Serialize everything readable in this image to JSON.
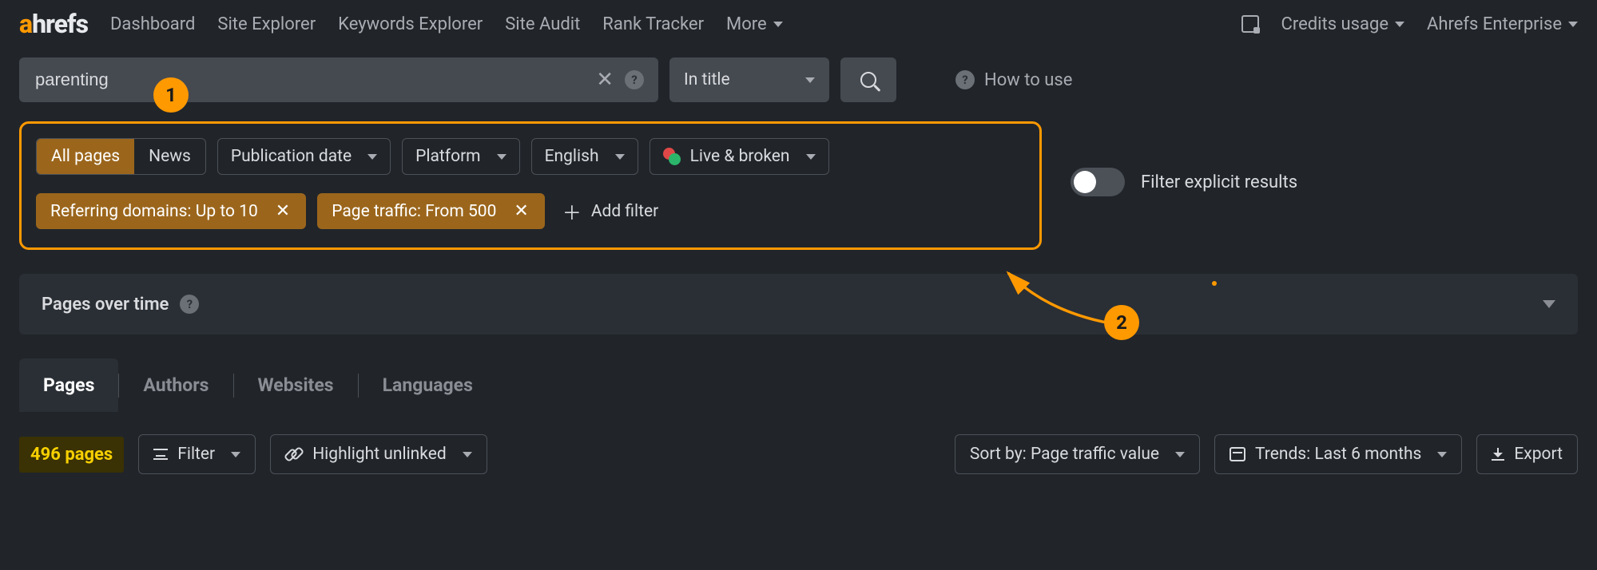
{
  "brand": {
    "a": "a",
    "rest": "hrefs"
  },
  "nav": {
    "items": [
      "Dashboard",
      "Site Explorer",
      "Keywords Explorer",
      "Site Audit",
      "Rank Tracker"
    ],
    "more": "More"
  },
  "topright": {
    "credits": "Credits usage",
    "plan": "Ahrefs Enterprise"
  },
  "search": {
    "value": "parenting",
    "scope": "In title",
    "how_to": "How to use"
  },
  "annotations": {
    "one": "1",
    "two": "2"
  },
  "filters": {
    "segment": {
      "active": "All pages",
      "other": "News"
    },
    "dropdowns": {
      "pub_date": "Publication date",
      "platform": "Platform",
      "language": "English",
      "live_broken": "Live & broken"
    },
    "applied": [
      {
        "label": "Referring domains: Up to 10"
      },
      {
        "label": "Page traffic: From 500"
      }
    ],
    "add": "Add filter",
    "explicit_toggle_label": "Filter explicit results"
  },
  "pages_over_time": {
    "title": "Pages over time"
  },
  "tabs": [
    "Pages",
    "Authors",
    "Websites",
    "Languages"
  ],
  "toolbar": {
    "page_count": "496 pages",
    "filter": "Filter",
    "highlight": "Highlight unlinked",
    "sort": "Sort by: Page traffic value",
    "trends": "Trends: Last 6 months",
    "export": "Export"
  }
}
